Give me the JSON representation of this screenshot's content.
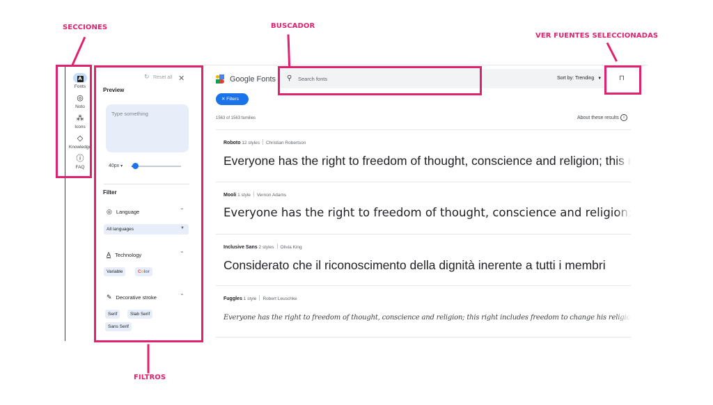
{
  "annotations": {
    "secciones": "SECCIONES",
    "buscador": "BUSCADOR",
    "ver_fuentes": "VER FUENTES SELECCIONADAS",
    "filtros": "FILTROS",
    "accent": "#e0226e"
  },
  "rail": {
    "items": [
      {
        "label": "Fonts",
        "icon": "fonts-icon",
        "glyph": "A"
      },
      {
        "label": "Noto",
        "icon": "globe-icon",
        "glyph": "🌐"
      },
      {
        "label": "Icons",
        "icon": "shapes-icon",
        "glyph": "⁂"
      },
      {
        "label": "Knowledge",
        "icon": "graduation-cap-icon",
        "glyph": "🎓"
      },
      {
        "label": "FAQ",
        "icon": "help-icon",
        "glyph": "?"
      }
    ]
  },
  "panel": {
    "reset_label": "Reset all",
    "preview_title": "Preview",
    "preview_placeholder": "Type something",
    "size_value": "40px",
    "filter_title": "Filter",
    "language_label": "Language",
    "language_value": "All languages",
    "technology_label": "Technology",
    "tech_chips": [
      "Variable",
      "Color"
    ],
    "decorative_label": "Decorative stroke",
    "stroke_chips": [
      "Serif",
      "Slab Serif",
      "Sans Serif"
    ]
  },
  "header": {
    "logo_text": "Google Fonts",
    "search_placeholder": "Search fonts",
    "sort_label": "Sort by: Trending",
    "filters_button": "Filters"
  },
  "results": {
    "count": "1563 of 1563 families",
    "about": "About these results"
  },
  "fonts": [
    {
      "name": "Roboto",
      "styles": "12 styles",
      "designer": "Christian Robertson",
      "sample": "Everyone has the right to freedom of thought, conscience and religion; this right"
    },
    {
      "name": "Mooli",
      "styles": "1 style",
      "designer": "Vernon Adams",
      "sample": "Everyone has the right to freedom of thought, conscience and religion; this"
    },
    {
      "name": "Inclusive Sans",
      "styles": "2 styles",
      "designer": "Olivia King",
      "sample": "Considerato che il riconoscimento della dignità inerente a tutti i membri"
    },
    {
      "name": "Fuggles",
      "styles": "1 style",
      "designer": "Robert Leuschke",
      "sample": "Everyone has the right to freedom of thought, conscience and religion; this right includes freedom to change his religion or belief, and freedom"
    }
  ]
}
